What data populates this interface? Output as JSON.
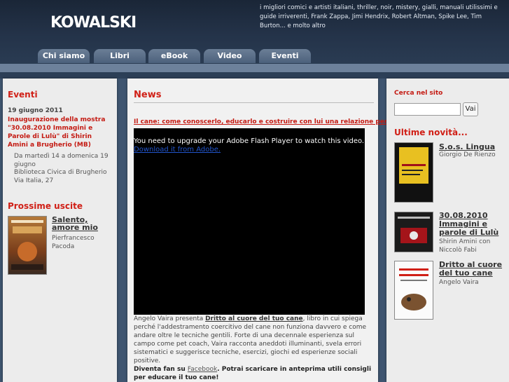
{
  "header": {
    "logo_text": "KOWALSKI",
    "tagline": "i migliori comici e artisti italiani, thriller, noir, mistery, gialli, manuali utilissimi e guide irriverenti, Frank Zappa, Jimi Hendrix, Robert Altman, Spike Lee, Tim Burton... e molto altro"
  },
  "nav": {
    "tabs": [
      "Chi siamo",
      "Libri",
      "eBook",
      "Video",
      "Eventi"
    ]
  },
  "left": {
    "events_title": "Eventi",
    "event_date": "19 giugno 2011",
    "event_title": "Inaugurazione della mostra \"30.08.2010 Immagini e Parole di Lulù\" di Shirin Amini a Brugherio (MB)",
    "event_when": "Da martedì 14 a domenica 19 giugno",
    "event_place": "Biblioteca Civica di Brugherio",
    "event_address": "Via Italia, 27",
    "upcoming_title": "Prossime uscite",
    "upcoming_book_title": "Salento, amore mio",
    "upcoming_book_author": "Pierfrancesco Pacoda"
  },
  "main": {
    "news_title": "News",
    "article_title": "Il cane: come conoscerlo, educarlo e costruire con lui una relazione perfetta",
    "flash_msg": "You need to upgrade your Adobe Flash Player to watch this video.",
    "flash_link": "Download it from Adobe.",
    "body_intro": "Angelo Vaira presenta ",
    "body_link": "Dritto al cuore del tuo cane",
    "body_rest": ", libro in cui spiega perché l'addestramento coercitivo del cane non funziona davvero e come andare oltre le tecniche gentili. Forte di una decennale esperienza sul campo come pet coach, Vaira racconta aneddoti illuminanti, svela errori sistematici e suggerisce tecniche, esercizi, giochi ed esperienze sociali positive.",
    "fan_prefix": "Diventa fan su ",
    "fan_link": "Facebook",
    "fan_suffix": ". Potrai scaricare in anteprima utili consigli per educare il tuo cane!"
  },
  "right": {
    "search_title": "Cerca nel sito",
    "search_value": "",
    "search_button": "Vai",
    "latest_title": "Ultime novità...",
    "books": [
      {
        "title": "S.o.s. Lingua",
        "author": "Giorgio De Rienzo"
      },
      {
        "title": "30.08.2010 Immagini e parole di Lulù",
        "author": "Shirin Amini con Niccolò Fabi"
      },
      {
        "title": "Dritto al cuore del tuo cane",
        "author": "Angelo Vaira"
      }
    ]
  },
  "colors": {
    "accent_red": "#d01f16",
    "header_dark": "#1f2d42",
    "page_bg": "#3f5570"
  }
}
